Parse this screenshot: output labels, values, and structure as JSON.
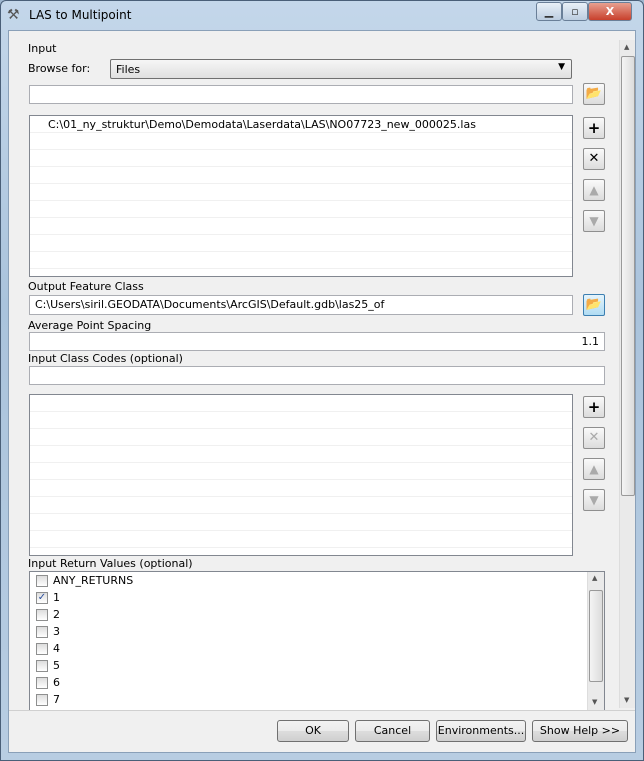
{
  "window": {
    "title": "LAS to Multipoint",
    "minimize": "▭",
    "maximize": "▣",
    "close": "X"
  },
  "input": {
    "label": "Input",
    "browse_label": "Browse for:",
    "browse_value": "Files",
    "path_value": "",
    "files": [
      "C:\\01_ny_struktur\\Demo\\Demodata\\Laserdata\\LAS\\NO07723_new_000025.las"
    ]
  },
  "output": {
    "label": "Output Feature Class",
    "value": "C:\\Users\\siril.GEODATA\\Documents\\ArcGIS\\Default.gdb\\las25_of"
  },
  "spacing": {
    "label": "Average Point Spacing",
    "value": "1.1"
  },
  "class_codes": {
    "label": "Input Class Codes (optional)",
    "value": ""
  },
  "return_values": {
    "label": "Input Return Values (optional)",
    "items": [
      {
        "label": "ANY_RETURNS",
        "checked": false
      },
      {
        "label": "1",
        "checked": true
      },
      {
        "label": "2",
        "checked": false
      },
      {
        "label": "3",
        "checked": false
      },
      {
        "label": "4",
        "checked": false
      },
      {
        "label": "5",
        "checked": false
      },
      {
        "label": "6",
        "checked": false
      },
      {
        "label": "7",
        "checked": false
      }
    ]
  },
  "icons": {
    "add": "+",
    "remove": "✕",
    "up": "🡅",
    "down": "🡇",
    "folder": "folder-open-icon"
  },
  "buttons": {
    "ok": "OK",
    "cancel": "Cancel",
    "environments": "Environments...",
    "help": "Show Help >>"
  }
}
